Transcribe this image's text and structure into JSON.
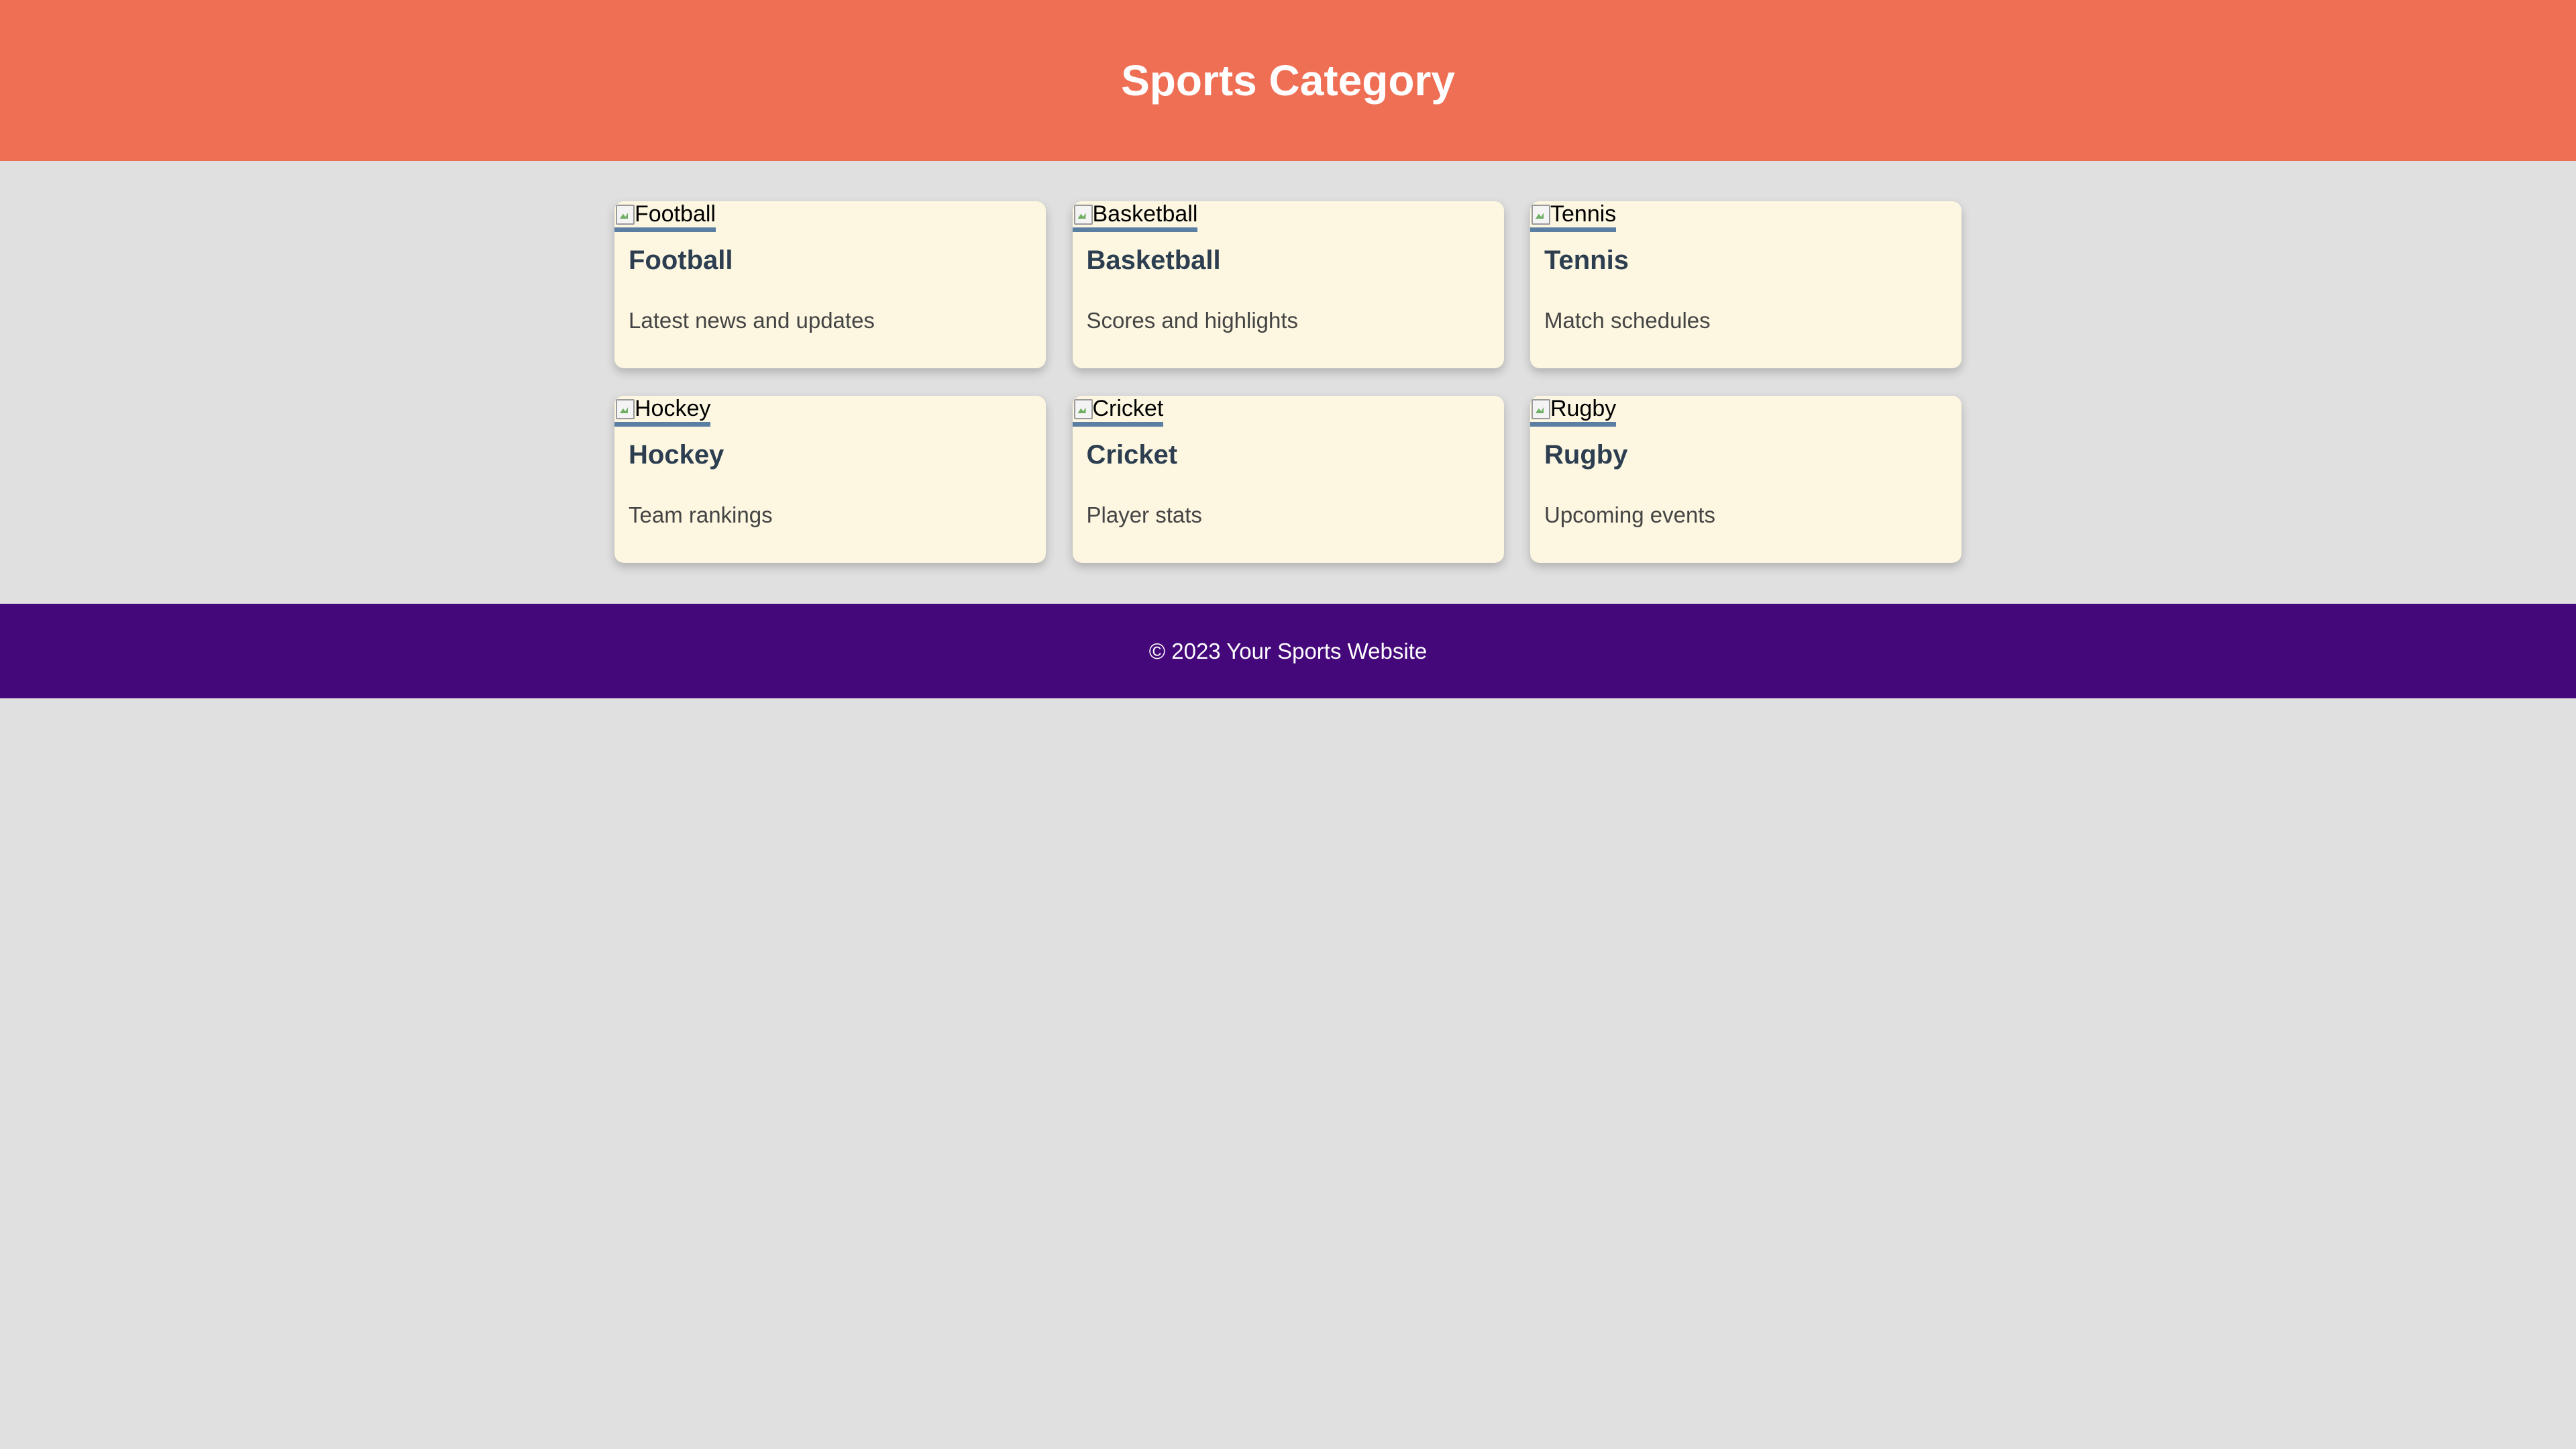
{
  "header": {
    "title": "Sports Category"
  },
  "categories": [
    {
      "image_alt": "Football",
      "title": "Football",
      "description": "Latest news and updates"
    },
    {
      "image_alt": "Basketball",
      "title": "Basketball",
      "description": "Scores and highlights"
    },
    {
      "image_alt": "Tennis",
      "title": "Tennis",
      "description": "Match schedules"
    },
    {
      "image_alt": "Hockey",
      "title": "Hockey",
      "description": "Team rankings"
    },
    {
      "image_alt": "Cricket",
      "title": "Cricket",
      "description": "Player stats"
    },
    {
      "image_alt": "Rugby",
      "title": "Rugby",
      "description": "Upcoming events"
    }
  ],
  "footer": {
    "copyright": "© 2023 Your Sports Website"
  },
  "colors": {
    "header_bg": "#ef6f55",
    "page_bg": "#e0e0e0",
    "card_bg": "#fdf7e1",
    "image_underline": "#5a7fa3",
    "card_title": "#2c3e50",
    "footer_bg": "#45087a"
  },
  "icons": {
    "card_image": "broken-image-icon"
  }
}
